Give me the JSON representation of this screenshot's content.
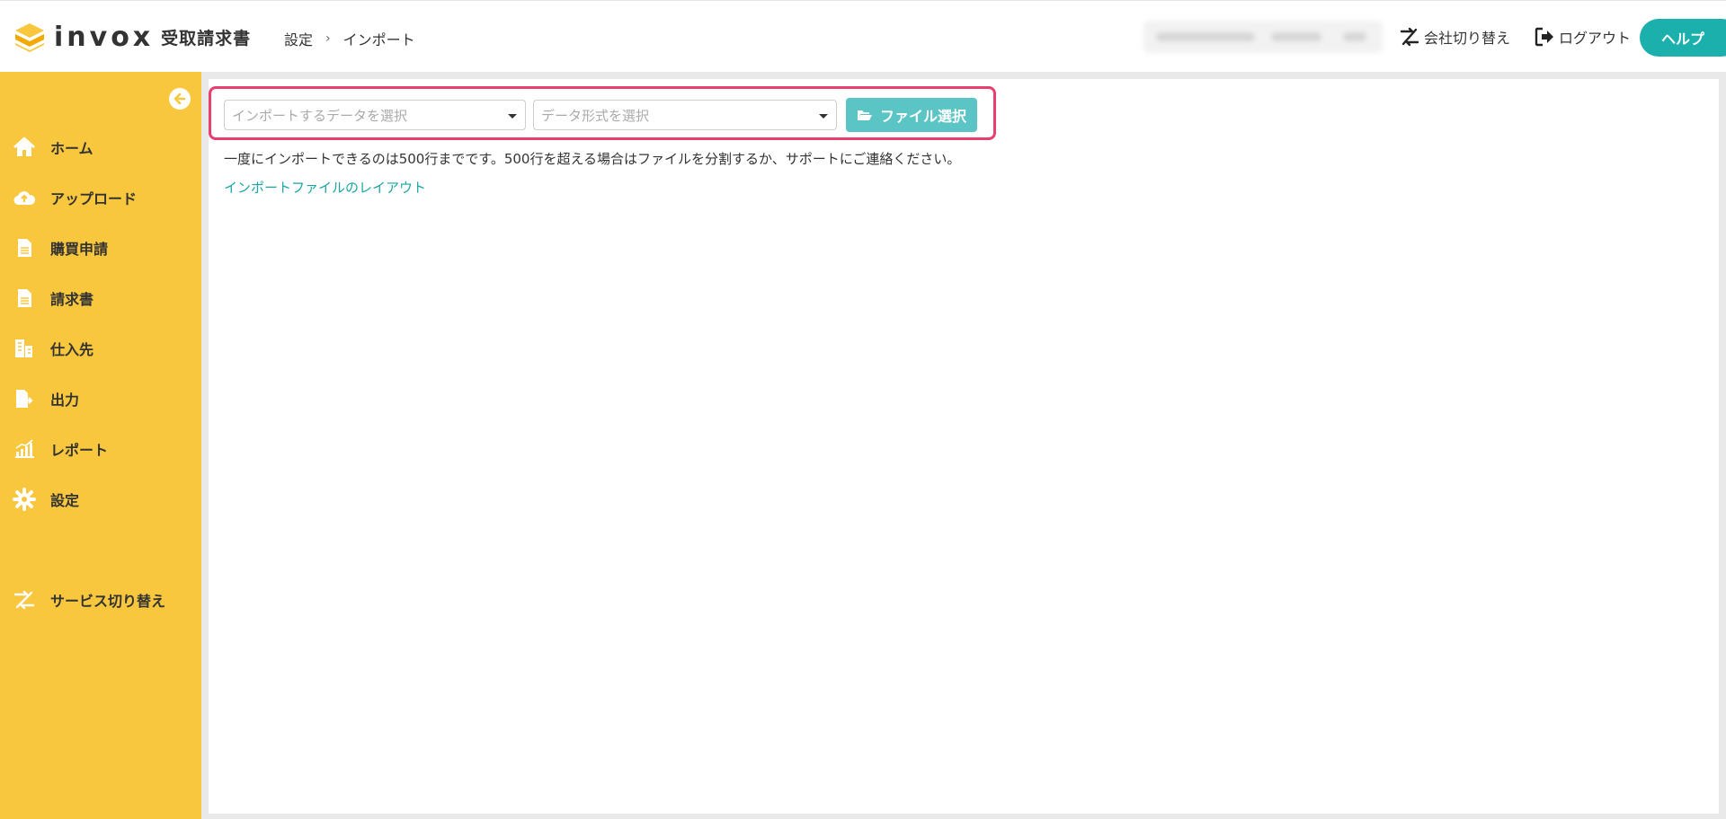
{
  "header": {
    "logo_word": "invox",
    "product_name": "受取請求書",
    "breadcrumb": {
      "parent": "設定",
      "current": "インポート"
    },
    "switch_company_label": "会社切り替え",
    "logout_label": "ログアウト",
    "help_label": "ヘルプ"
  },
  "sidebar": {
    "items": [
      {
        "label": "ホーム",
        "icon": "home-icon"
      },
      {
        "label": "アップロード",
        "icon": "cloud-upload-icon"
      },
      {
        "label": "購買申請",
        "icon": "document-icon"
      },
      {
        "label": "請求書",
        "icon": "document-icon"
      },
      {
        "label": "仕入先",
        "icon": "building-icon"
      },
      {
        "label": "出力",
        "icon": "file-export-icon"
      },
      {
        "label": "レポート",
        "icon": "chart-icon"
      },
      {
        "label": "設定",
        "icon": "gear-icon"
      },
      {
        "label": "サービス切り替え",
        "icon": "switch-icon"
      }
    ]
  },
  "import": {
    "data_select_placeholder": "インポートするデータを選択",
    "format_select_placeholder": "データ形式を選択",
    "file_button_label": "ファイル選択",
    "limit_note": "一度にインポートできるのは500行までです。500行を超える場合はファイルを分割するか、サポートにご連絡ください。",
    "layout_link_label": "インポートファイルのレイアウト"
  },
  "colors": {
    "sidebar_bg": "#f9c73d",
    "accent": "#1cb0ad",
    "highlight_border": "#e83e70",
    "file_button": "#5bc4c4"
  }
}
